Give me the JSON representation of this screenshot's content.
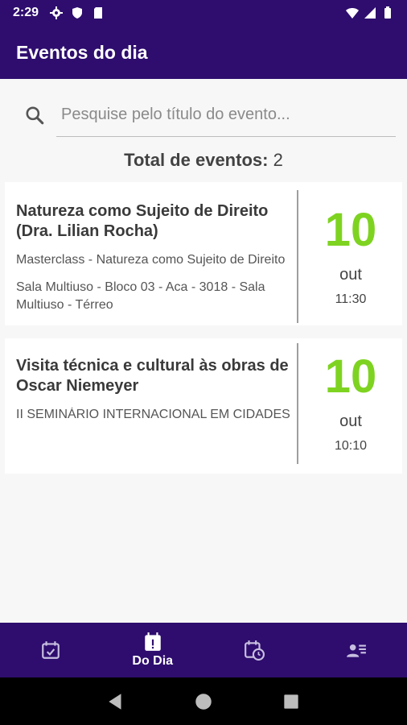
{
  "status_bar": {
    "time": "2:29",
    "left_icons": [
      "gear-icon",
      "shield-icon",
      "sd-card-icon"
    ],
    "right_icons": [
      "wifi-icon",
      "signal-icon",
      "battery-icon"
    ]
  },
  "app_bar": {
    "title": "Eventos do dia"
  },
  "search": {
    "placeholder": "Pesquise pelo título do evento..."
  },
  "total": {
    "label": "Total de eventos:",
    "value": "2"
  },
  "events": [
    {
      "title": "Natureza como Sujeito de Direito (Dra. Lilian Rocha)",
      "subtitle": "Masterclass - Natureza como Sujeito de Direito",
      "location": "Sala Multiuso - Bloco 03 - Aca - 3018 - Sala Multiuso - Térreo",
      "day": "10",
      "month": "out",
      "time": "11:30"
    },
    {
      "title": "Visita técnica e cultural às obras de Oscar Niemeyer",
      "subtitle": "II SEMINÁRIO INTERNACIONAL EM CIDADES",
      "day": "10",
      "month": "out",
      "time": "10:10"
    }
  ],
  "bottom_nav": {
    "items": [
      {
        "icon": "calendar-check-icon",
        "label": ""
      },
      {
        "icon": "calendar-alert-icon",
        "label": "Do Dia",
        "active": true
      },
      {
        "icon": "calendar-clock-icon",
        "label": ""
      },
      {
        "icon": "contact-list-icon",
        "label": ""
      }
    ]
  },
  "colors": {
    "primary": "#2e0d6e",
    "accent_green": "#7ed321"
  }
}
